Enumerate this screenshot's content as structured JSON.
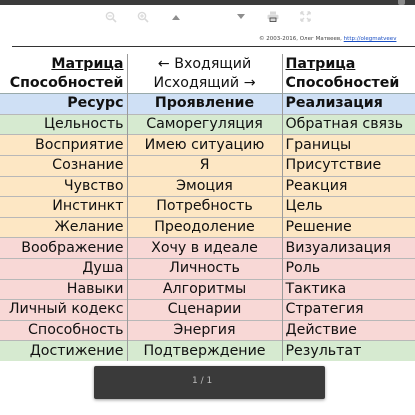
{
  "copyright": {
    "text": "© 2003-2016, Олег Матвеев,",
    "link": "http://olegmatveev"
  },
  "header": {
    "left_line1": "Матрица",
    "left_line2": "Способностей",
    "mid_line1": "← Входящий",
    "mid_line2": "Исходящий →",
    "right_line1": "Патрица",
    "right_line2": "Способностей"
  },
  "categories": {
    "left": "Ресурс",
    "mid": "Проявление",
    "right": "Реализация"
  },
  "rows": [
    {
      "left": "Цельность",
      "mid": "Саморегуляция",
      "right": "Обратная связь",
      "color": "#d6ead0"
    },
    {
      "left": "Восприятие",
      "mid": "Имею ситуацию",
      "right": "Границы",
      "color": "#fde7c4"
    },
    {
      "left": "Сознание",
      "mid": "Я",
      "right": "Присутствие",
      "color": "#fde7c4"
    },
    {
      "left": "Чувство",
      "mid": "Эмоция",
      "right": "Реакция",
      "color": "#fde7c4"
    },
    {
      "left": "Инстинкт",
      "mid": "Потребность",
      "right": "Цель",
      "color": "#fde7c4"
    },
    {
      "left": "Желание",
      "mid": "Преодоление",
      "right": "Решение",
      "color": "#fde7c4"
    },
    {
      "left": "Воображение",
      "mid": "Хочу в идеале",
      "right": "Визуализация",
      "color": "#f8d8d6"
    },
    {
      "left": "Душа",
      "mid": "Личность",
      "right": "Роль",
      "color": "#f8d8d6"
    },
    {
      "left": "Навыки",
      "mid": "Алгоритмы",
      "right": "Тактика",
      "color": "#f8d8d6"
    },
    {
      "left": "Личный кодекс",
      "mid": "Сценарии",
      "right": "Стратегия",
      "color": "#f8d8d6"
    },
    {
      "left": "Способность",
      "mid": "Энергия",
      "right": "Действие",
      "color": "#f8d8d6"
    },
    {
      "left": "Достижение",
      "mid": "Подтверждение",
      "right": "Результат",
      "color": "#d6ead0"
    }
  ],
  "toolbar": {
    "zoom_out_icon": "zoom-out-icon",
    "zoom_in_icon": "zoom-in-icon",
    "prev_icon": "arrow-up-icon",
    "page": "1 / 1",
    "next_icon": "arrow-down-icon",
    "print_icon": "print-icon",
    "fullscreen_icon": "fullscreen-icon"
  }
}
